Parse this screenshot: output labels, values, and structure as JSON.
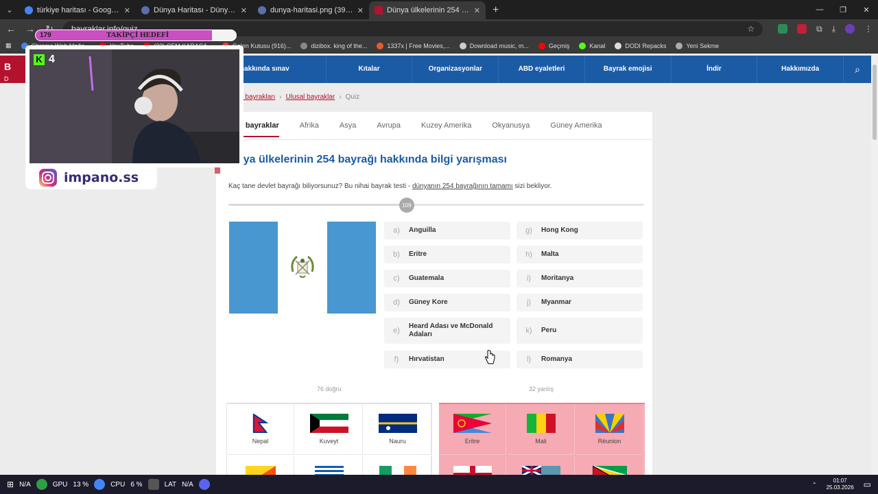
{
  "browser": {
    "tabs": [
      {
        "title": "türkiye haritası - Google'da Ara",
        "color": "#4285f4",
        "active": false
      },
      {
        "title": "Dünya Haritası - Dünya Siyasi H",
        "color": "#5b6fa8",
        "active": false
      },
      {
        "title": "dunya-haritasi.png (3904×2551",
        "color": "#5b6fa8",
        "active": false
      },
      {
        "title": "Dünya ülkelerinin 254 bayrağı h",
        "color": "#b3122e",
        "active": true
      }
    ],
    "new_tab_label": "+",
    "url": "bayraklar.info/quiz",
    "bookmarks": [
      {
        "label": "Chrome Web Mağa...",
        "color": "#4285f4"
      },
      {
        "label": "YouTube",
        "color": "#ff0000"
      },
      {
        "label": "(32) CEM KARACA...",
        "color": "#ff0000"
      },
      {
        "label": "Gelen Kutusu (916)...",
        "color": "#ea4335"
      },
      {
        "label": "dizibox. king of the...",
        "color": "#888888"
      },
      {
        "label": "1337x | Free Movies,...",
        "color": "#e55b2d"
      },
      {
        "label": "Download music, m...",
        "color": "#cccccc"
      },
      {
        "label": "Geçmiş",
        "color": "#ff0000"
      },
      {
        "label": "Kanal",
        "color": "#53fc18"
      },
      {
        "label": "DODI Repacks",
        "color": "#dddddd"
      },
      {
        "label": "Yeni Sekme",
        "color": "#aaaaaa"
      }
    ]
  },
  "site": {
    "logo_text": "B",
    "logo_sub": "D",
    "nav": [
      "hakkında sınav",
      "Kıtalar",
      "Organizasyonlar",
      "ABD eyaletleri",
      "Bayrak emojisi",
      "İndir",
      "Hakkımızda"
    ],
    "breadcrumb": [
      "ya bayrakları",
      "Ulusal bayraklar",
      "Quiz"
    ],
    "subtabs": [
      "m bayraklar",
      "Afrika",
      "Asya",
      "Avrupa",
      "Kuzey Amerika",
      "Okyanusya",
      "Güney Amerika"
    ],
    "quiz_title": "nya ülkelerinin 254 bayrağı hakkında bilgi yarışması",
    "desc_before": "Kaç tane devlet bayrağı biliyorsunuz? Bu nihai bayrak testi - ",
    "desc_link": "dünyanın 254 bayrağının tamamı",
    "desc_after": " sizi bekliyor.",
    "progress_value": 109,
    "progress_total": 254,
    "question_flag": "guatemala-flag",
    "answers": [
      {
        "letter": "a)",
        "label": "Anguilla"
      },
      {
        "letter": "b)",
        "label": "Eritre"
      },
      {
        "letter": "c)",
        "label": "Guatemala"
      },
      {
        "letter": "d)",
        "label": "Güney Kore"
      },
      {
        "letter": "e)",
        "label": "Heard Adası ve McDonald Adaları"
      },
      {
        "letter": "f)",
        "label": "Hırvatistan"
      },
      {
        "letter": "g)",
        "label": "Hong Kong"
      },
      {
        "letter": "h)",
        "label": "Malta"
      },
      {
        "letter": "i)",
        "label": "Moritanya"
      },
      {
        "letter": "j)",
        "label": "Myanmar"
      },
      {
        "letter": "k)",
        "label": "Peru"
      },
      {
        "letter": "l)",
        "label": "Romanya"
      }
    ],
    "correct_label": "76 doğru",
    "wrong_label": "32 yanlış",
    "correct_flags": [
      "Nepal",
      "Kuveyt",
      "Nauru"
    ],
    "wrong_flags": [
      "Eritre",
      "Mali",
      "Réunion"
    ]
  },
  "overlay": {
    "goal_count": "179",
    "goal_label": "TAKİPÇİ HEDEFİ",
    "goal_fraction": 0.88,
    "kick_logo": "K",
    "kick_count": "4",
    "instagram_handle": "impano.ss"
  },
  "taskbar": {
    "items": [
      "N/A",
      "GPU",
      "13 %",
      "CPU",
      "6 %",
      "LAT",
      "N/A"
    ],
    "time": "01:07",
    "date": "25.03.2026"
  },
  "colors": {
    "accent_red": "#b3122e",
    "nav_blue": "#1b5ba6",
    "wrong_bg": "#f6aab3"
  }
}
